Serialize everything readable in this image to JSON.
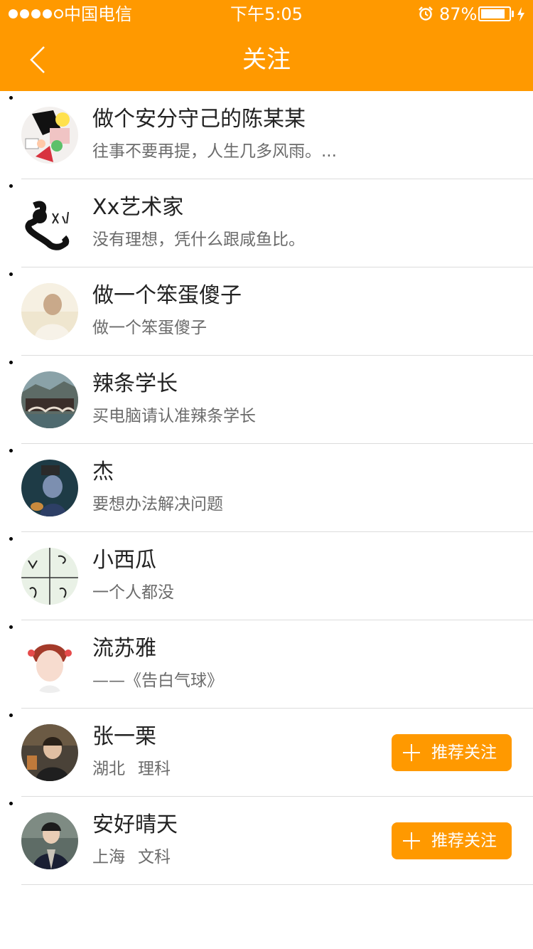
{
  "status_bar": {
    "carrier": "中国电信",
    "time": "下午5:05",
    "battery": "87%",
    "battery_level": 0.87,
    "signal_bars_filled": 4,
    "signal_bars_total": 5,
    "icons": [
      "signal-dots-icon",
      "alarm-icon",
      "battery-icon",
      "charging-bolt-icon"
    ]
  },
  "header": {
    "title": "关注",
    "back_icon": "chevron-left-icon",
    "background": "#ff9900"
  },
  "follow_list": [
    {
      "name": "做个安分守己的陈某某",
      "desc": "往事不要再提，人生几多风雨。..."
    },
    {
      "name": "Xx艺术家",
      "desc": "没有理想，凭什么跟咸鱼比。"
    },
    {
      "name": "做一个笨蛋傻子",
      "desc": "做一个笨蛋傻子"
    },
    {
      "name": "辣条学长",
      "desc": "买电脑请认准辣条学长"
    },
    {
      "name": "杰",
      "desc": "要想办法解决问题"
    },
    {
      "name": "小西瓜",
      "desc": "一个人都没"
    },
    {
      "name": "流苏雅",
      "desc": "——《告白气球》"
    },
    {
      "name": "张一栗",
      "location": "湖北",
      "subject": "理科",
      "button": "推荐关注"
    },
    {
      "name": "安好晴天",
      "location": "上海",
      "subject": "文科",
      "button": "推荐关注"
    }
  ],
  "colors": {
    "accent": "#ff9900",
    "name_text": "#222222",
    "desc_text": "#6b6b6b",
    "divider": "#dcdcdc"
  }
}
